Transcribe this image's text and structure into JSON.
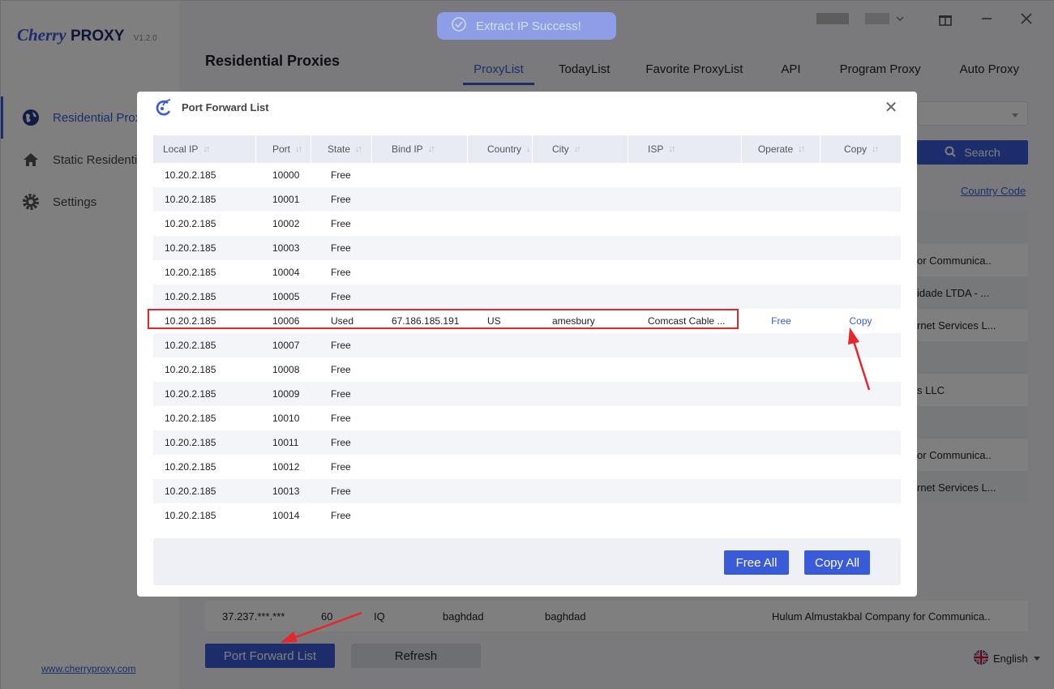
{
  "app": {
    "logo_main": "Cherry",
    "logo_proxy": "PROXY",
    "version": "V1.2.0",
    "site_link": "www.cherryproxy.com"
  },
  "sidebar": {
    "items": [
      {
        "label": "Residential Proxies",
        "icon": "globe-icon"
      },
      {
        "label": "Static Residential Proxies",
        "icon": "home-icon"
      },
      {
        "label": "Settings",
        "icon": "gear-icon"
      }
    ]
  },
  "header": {
    "title": "Residential Proxies",
    "tabs": [
      "ProxyList",
      "TodayList",
      "Favorite ProxyList",
      "API",
      "Program Proxy",
      "Auto Proxy"
    ],
    "active_tab": "ProxyList"
  },
  "background": {
    "search_label": "Search",
    "country_code_label": "Country Code ",
    "row_fragments": [
      "or Communica..",
      "idade LTDA - ...",
      "rnet Services L...",
      "s LLC",
      "or Communica..",
      "rnet Services L..."
    ],
    "bottom_row": {
      "ip": "37.237.***.***",
      "num": "60",
      "country": "IQ",
      "state": "baghdad",
      "city": "baghdad",
      "isp": "Hulum Almustakbal Company for Communica.."
    },
    "port_forward_button": "Port Forward List",
    "refresh_button": "Refresh",
    "language": "English"
  },
  "toast": {
    "message": "Extract IP Success!"
  },
  "modal": {
    "title": "Port Forward List",
    "columns": [
      "Local IP",
      "Port",
      "State",
      "Bind IP",
      "Country",
      "City",
      "ISP",
      "Operate",
      "Copy"
    ],
    "rows": [
      {
        "local_ip": "10.20.2.185",
        "port": "10000",
        "state": "Free",
        "bind_ip": "",
        "country": "",
        "city": "",
        "isp": "",
        "operate": "",
        "copy": ""
      },
      {
        "local_ip": "10.20.2.185",
        "port": "10001",
        "state": "Free",
        "bind_ip": "",
        "country": "",
        "city": "",
        "isp": "",
        "operate": "",
        "copy": ""
      },
      {
        "local_ip": "10.20.2.185",
        "port": "10002",
        "state": "Free",
        "bind_ip": "",
        "country": "",
        "city": "",
        "isp": "",
        "operate": "",
        "copy": ""
      },
      {
        "local_ip": "10.20.2.185",
        "port": "10003",
        "state": "Free",
        "bind_ip": "",
        "country": "",
        "city": "",
        "isp": "",
        "operate": "",
        "copy": ""
      },
      {
        "local_ip": "10.20.2.185",
        "port": "10004",
        "state": "Free",
        "bind_ip": "",
        "country": "",
        "city": "",
        "isp": "",
        "operate": "",
        "copy": ""
      },
      {
        "local_ip": "10.20.2.185",
        "port": "10005",
        "state": "Free",
        "bind_ip": "",
        "country": "",
        "city": "",
        "isp": "",
        "operate": "",
        "copy": ""
      },
      {
        "local_ip": "10.20.2.185",
        "port": "10006",
        "state": "Used",
        "bind_ip": "67.186.185.191",
        "country": "US",
        "city": "amesbury",
        "isp": "Comcast Cable ...",
        "operate": "Free",
        "copy": "Copy"
      },
      {
        "local_ip": "10.20.2.185",
        "port": "10007",
        "state": "Free",
        "bind_ip": "",
        "country": "",
        "city": "",
        "isp": "",
        "operate": "",
        "copy": ""
      },
      {
        "local_ip": "10.20.2.185",
        "port": "10008",
        "state": "Free",
        "bind_ip": "",
        "country": "",
        "city": "",
        "isp": "",
        "operate": "",
        "copy": ""
      },
      {
        "local_ip": "10.20.2.185",
        "port": "10009",
        "state": "Free",
        "bind_ip": "",
        "country": "",
        "city": "",
        "isp": "",
        "operate": "",
        "copy": ""
      },
      {
        "local_ip": "10.20.2.185",
        "port": "10010",
        "state": "Free",
        "bind_ip": "",
        "country": "",
        "city": "",
        "isp": "",
        "operate": "",
        "copy": ""
      },
      {
        "local_ip": "10.20.2.185",
        "port": "10011",
        "state": "Free",
        "bind_ip": "",
        "country": "",
        "city": "",
        "isp": "",
        "operate": "",
        "copy": ""
      },
      {
        "local_ip": "10.20.2.185",
        "port": "10012",
        "state": "Free",
        "bind_ip": "",
        "country": "",
        "city": "",
        "isp": "",
        "operate": "",
        "copy": ""
      },
      {
        "local_ip": "10.20.2.185",
        "port": "10013",
        "state": "Free",
        "bind_ip": "",
        "country": "",
        "city": "",
        "isp": "",
        "operate": "",
        "copy": ""
      },
      {
        "local_ip": "10.20.2.185",
        "port": "10014",
        "state": "Free",
        "bind_ip": "",
        "country": "",
        "city": "",
        "isp": "",
        "operate": "",
        "copy": ""
      }
    ],
    "free_all_button": "Free All",
    "copy_all_button": "Copy All"
  },
  "colors": {
    "accent": "#3a5bd9",
    "highlight_border": "#e5262b",
    "annotation_arrow": "#e5262b"
  }
}
